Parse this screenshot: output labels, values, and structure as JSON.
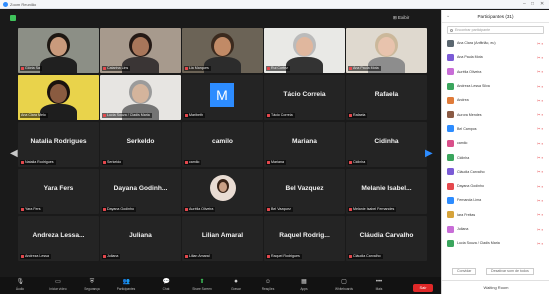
{
  "window": {
    "title": "Zoom Reunião",
    "minimize": "–",
    "maximize": "□",
    "close": "✕"
  },
  "view_button": "⊞ Exibir",
  "navigation": {
    "prev": "◀",
    "next": "▶"
  },
  "tiles": [
    {
      "label": "Glória Sa",
      "name": "",
      "photo": "man-dark",
      "active": false,
      "muted": true
    },
    {
      "label": "Catarina Lins",
      "name": "",
      "photo": "woman-dark",
      "active": false,
      "muted": true
    },
    {
      "label": "Lia Marques",
      "name": "",
      "photo": "man-headset",
      "active": false,
      "muted": true
    },
    {
      "label": "Rui Cortez",
      "name": "",
      "photo": "man-white",
      "active": false,
      "muted": true
    },
    {
      "label": "Ana Paula Mota",
      "name": "",
      "photo": "woman-light",
      "active": false,
      "muted": true
    },
    {
      "label": "Ana Clara Melo",
      "name": "",
      "photo": "woman-yellow",
      "active": true,
      "muted": false
    },
    {
      "label": "Lucia Souza / Cladis Maria",
      "name": "",
      "photo": "woman-grey",
      "active": false,
      "muted": true
    },
    {
      "label": "Maribeth",
      "name": "",
      "photo": "avatar-m",
      "active": false,
      "muted": true
    },
    {
      "label": "Tácio Correia",
      "name": "Tácio Correia",
      "photo": "",
      "active": false,
      "muted": true
    },
    {
      "label": "Rafaela",
      "name": "Rafaela",
      "photo": "",
      "active": false,
      "muted": true
    },
    {
      "label": "Natalia Rodrigues",
      "name": "Natalia Rodrigues",
      "photo": "",
      "active": false,
      "muted": true
    },
    {
      "label": "Serkeldo",
      "name": "Serkeldo",
      "photo": "",
      "active": false,
      "muted": true
    },
    {
      "label": "camilo",
      "name": "camilo",
      "photo": "",
      "active": false,
      "muted": true
    },
    {
      "label": "Mariana",
      "name": "Mariana",
      "photo": "",
      "active": false,
      "muted": true
    },
    {
      "label": "Cidinha",
      "name": "Cidinha",
      "photo": "",
      "active": false,
      "muted": true
    },
    {
      "label": "Yara Fers",
      "name": "Yara Fers",
      "photo": "",
      "active": false,
      "muted": true
    },
    {
      "label": "Dayana Godinho",
      "name": "Dayana Godinh...",
      "photo": "",
      "active": false,
      "muted": true
    },
    {
      "label": "Aurélia Oliveira",
      "name": "",
      "photo": "avatar-round",
      "active": false,
      "muted": true
    },
    {
      "label": "Bel Vazquez",
      "name": "Bel Vazquez",
      "photo": "",
      "active": false,
      "muted": true
    },
    {
      "label": "Melanie Isabel Fernandes",
      "name": "Melanie Isabel...",
      "photo": "",
      "active": false,
      "muted": true
    },
    {
      "label": "Andreza Lessa",
      "name": "Andreza Lessa...",
      "photo": "",
      "active": false,
      "muted": true
    },
    {
      "label": "Juliana",
      "name": "Juliana",
      "photo": "",
      "active": false,
      "muted": true
    },
    {
      "label": "Lilian Amaral",
      "name": "Lilian Amaral",
      "photo": "",
      "active": false,
      "muted": true
    },
    {
      "label": "Raquel Rodrigues",
      "name": "Raquel Rodrig...",
      "photo": "",
      "active": false,
      "muted": true
    },
    {
      "label": "Cláudia Carvalho",
      "name": "Cláudia Carvalho",
      "photo": "",
      "active": false,
      "muted": true
    }
  ],
  "toolbar": {
    "items": [
      {
        "label": "Áudio",
        "icon": "mic-icon",
        "glyph": "🎙"
      },
      {
        "label": "Iniciar vídeo",
        "icon": "video-icon",
        "glyph": "▭"
      },
      {
        "label": "Segurança",
        "icon": "shield-icon",
        "glyph": "⛨"
      },
      {
        "label": "Participantes",
        "icon": "participants-icon",
        "glyph": "👥"
      },
      {
        "label": "Chat",
        "icon": "chat-icon",
        "glyph": "💬"
      },
      {
        "label": "Share Screen",
        "icon": "share-screen-icon",
        "glyph": "⬆"
      },
      {
        "label": "Gravar",
        "icon": "record-icon",
        "glyph": "⏺"
      },
      {
        "label": "Reações",
        "icon": "reactions-icon",
        "glyph": "☺"
      },
      {
        "label": "Apps",
        "icon": "apps-icon",
        "glyph": "▦"
      },
      {
        "label": "Whiteboards",
        "icon": "whiteboard-icon",
        "glyph": "▢"
      },
      {
        "label": "Mais",
        "icon": "more-icon",
        "glyph": "•••"
      }
    ],
    "end_label": "Sair"
  },
  "panel": {
    "title": "Participantes (31)",
    "search_placeholder": "Encontrar participante",
    "participants": [
      {
        "name": "Ana Clara (Anfitrião, eu)",
        "color": "#5b6770"
      },
      {
        "name": "Ana Paula Mota",
        "color": "#7b5bd6"
      },
      {
        "name": "Aurélia Oliveira",
        "color": "#c86dd7"
      },
      {
        "name": "Andreza Lessa Silva",
        "color": "#3aa55d"
      },
      {
        "name": "Andrea",
        "color": "#e07b39"
      },
      {
        "name": "Aurora Mendes",
        "color": "#8a5a44"
      },
      {
        "name": "Bel Campos",
        "color": "#2d8cff"
      },
      {
        "name": "camilo",
        "color": "#d94f8a"
      },
      {
        "name": "Cidinha",
        "color": "#3aa55d"
      },
      {
        "name": "Cláudia Carvalho",
        "color": "#7b5bd6"
      },
      {
        "name": "Dayana Godinho",
        "color": "#e5484d"
      },
      {
        "name": "Fernanda Lima",
        "color": "#2d8cff"
      },
      {
        "name": "Iara Freitas",
        "color": "#d6a33a"
      },
      {
        "name": "Juliana",
        "color": "#c86dd7"
      },
      {
        "name": "Lucia Souza / Cladis Maria",
        "color": "#3aa55d"
      }
    ],
    "mic_glyph": "🎤̸",
    "invite": "Convidar",
    "mute_all": "Desativar som de todos",
    "waiting_room": "Waiting Room"
  }
}
